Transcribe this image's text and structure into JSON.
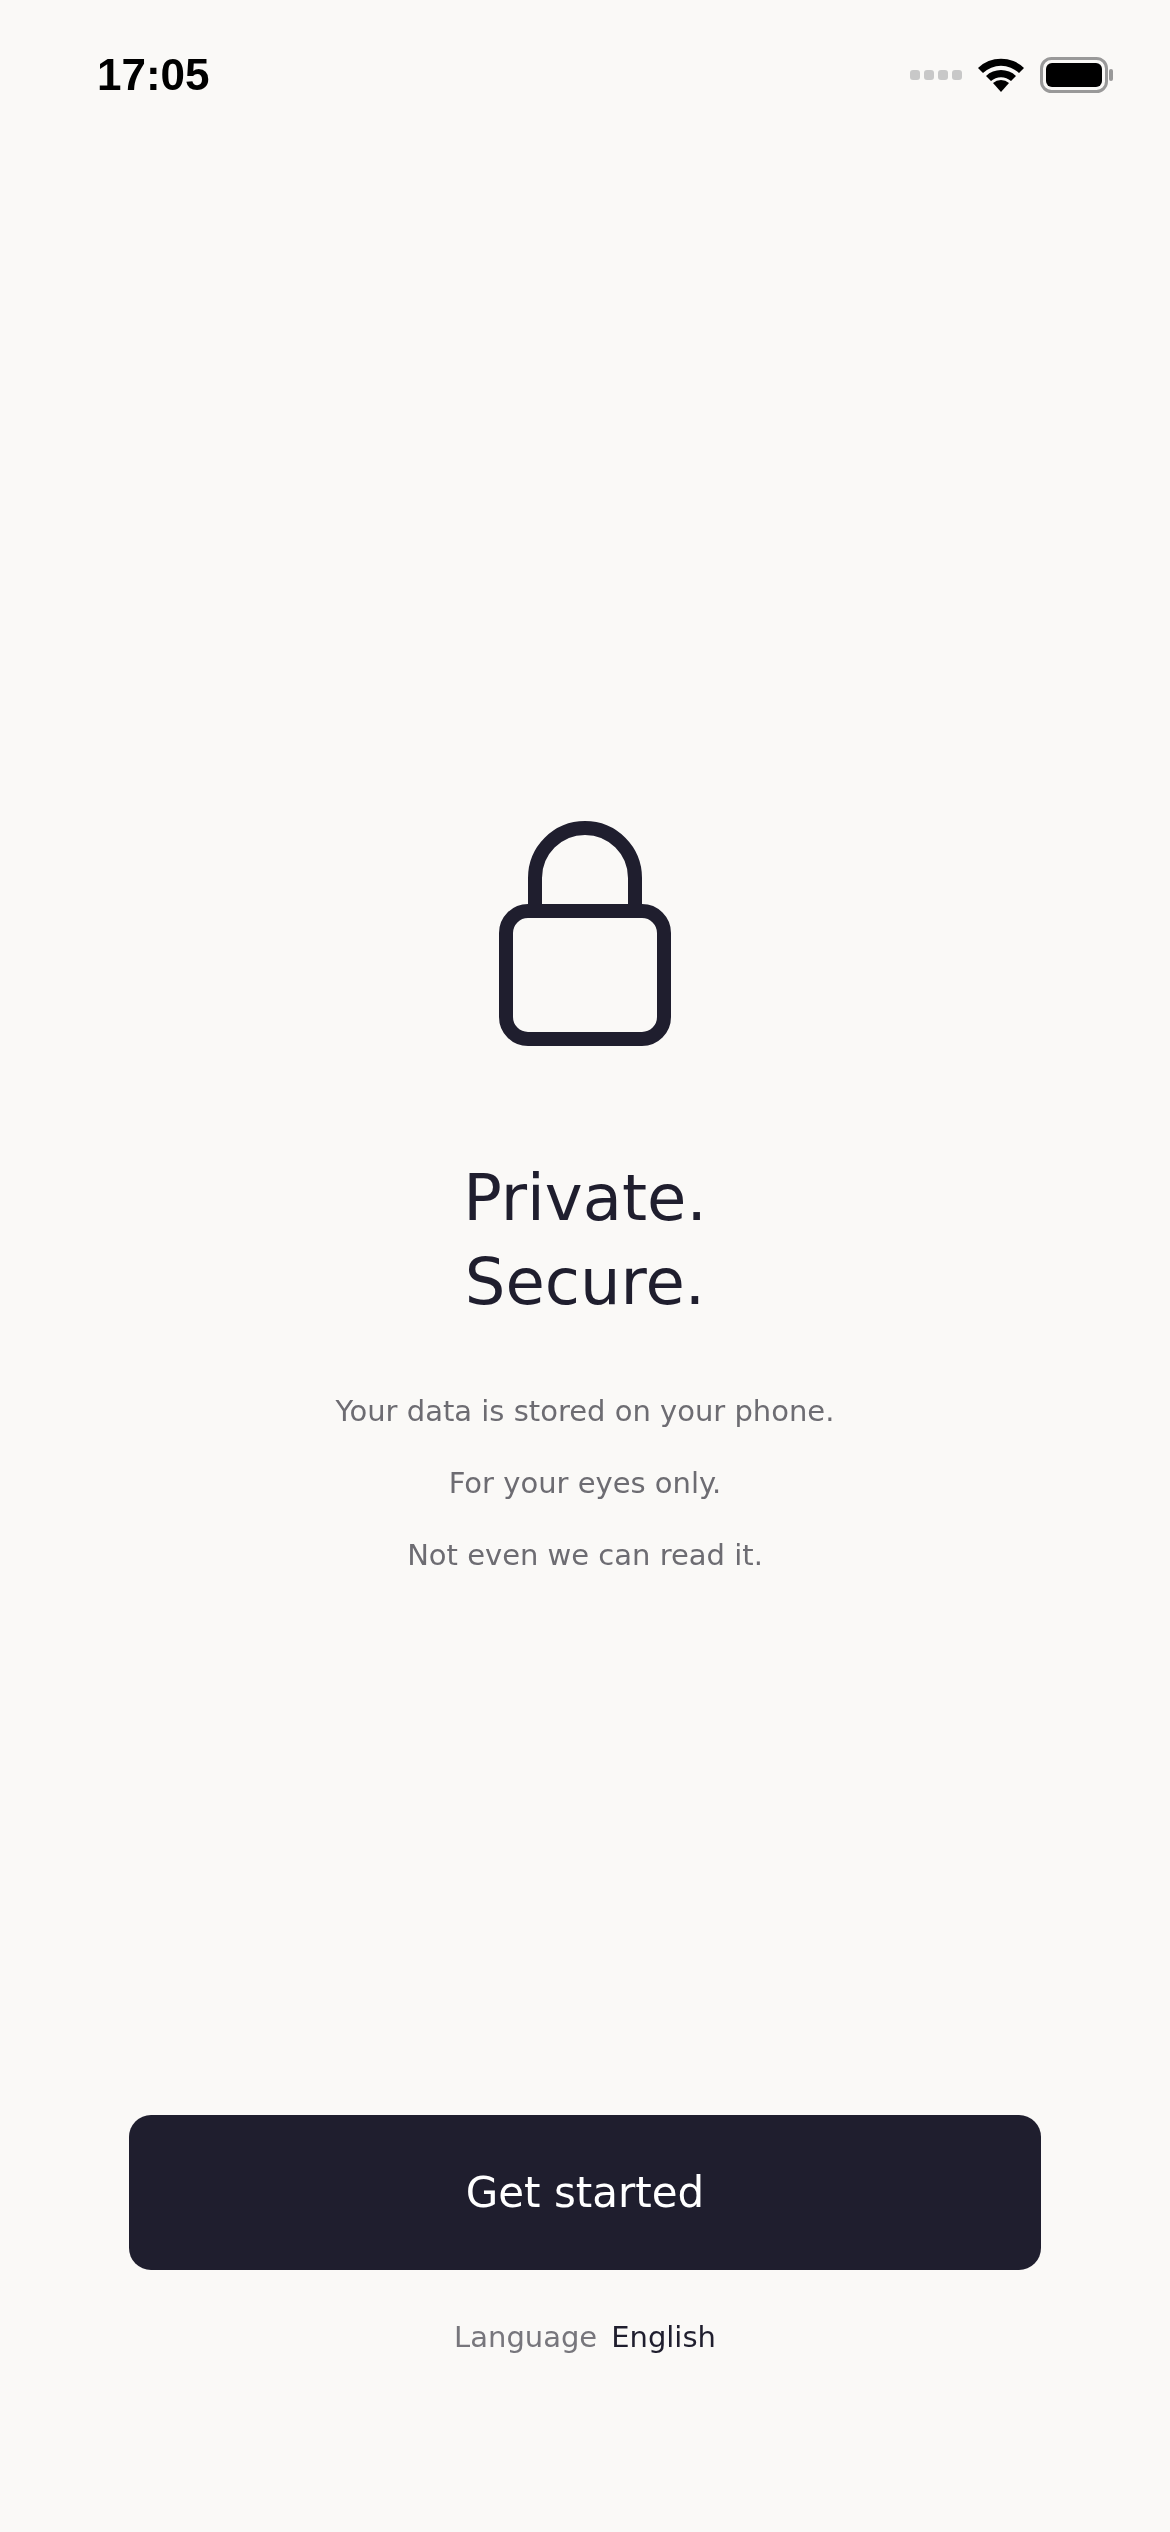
{
  "status_bar": {
    "time": "17:05"
  },
  "title_lines": [
    "Private.",
    "Secure."
  ],
  "body_lines": [
    "Your data is stored on your phone.",
    "For your eyes only.",
    "Not even we can read it."
  ],
  "primary_button": {
    "label": "Get started"
  },
  "language": {
    "label": "Language",
    "value": "English"
  }
}
